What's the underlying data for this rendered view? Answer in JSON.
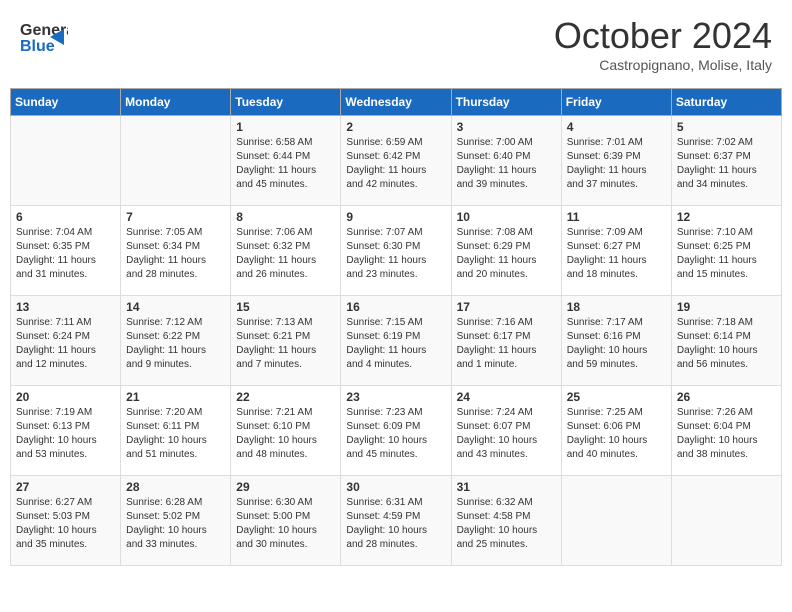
{
  "header": {
    "logo_general": "General",
    "logo_blue": "Blue",
    "month_title": "October 2024",
    "subtitle": "Castropignano, Molise, Italy"
  },
  "days_of_week": [
    "Sunday",
    "Monday",
    "Tuesday",
    "Wednesday",
    "Thursday",
    "Friday",
    "Saturday"
  ],
  "weeks": [
    [
      {
        "day": "",
        "content": ""
      },
      {
        "day": "",
        "content": ""
      },
      {
        "day": "1",
        "content": "Sunrise: 6:58 AM\nSunset: 6:44 PM\nDaylight: 11 hours and 45 minutes."
      },
      {
        "day": "2",
        "content": "Sunrise: 6:59 AM\nSunset: 6:42 PM\nDaylight: 11 hours and 42 minutes."
      },
      {
        "day": "3",
        "content": "Sunrise: 7:00 AM\nSunset: 6:40 PM\nDaylight: 11 hours and 39 minutes."
      },
      {
        "day": "4",
        "content": "Sunrise: 7:01 AM\nSunset: 6:39 PM\nDaylight: 11 hours and 37 minutes."
      },
      {
        "day": "5",
        "content": "Sunrise: 7:02 AM\nSunset: 6:37 PM\nDaylight: 11 hours and 34 minutes."
      }
    ],
    [
      {
        "day": "6",
        "content": "Sunrise: 7:04 AM\nSunset: 6:35 PM\nDaylight: 11 hours and 31 minutes."
      },
      {
        "day": "7",
        "content": "Sunrise: 7:05 AM\nSunset: 6:34 PM\nDaylight: 11 hours and 28 minutes."
      },
      {
        "day": "8",
        "content": "Sunrise: 7:06 AM\nSunset: 6:32 PM\nDaylight: 11 hours and 26 minutes."
      },
      {
        "day": "9",
        "content": "Sunrise: 7:07 AM\nSunset: 6:30 PM\nDaylight: 11 hours and 23 minutes."
      },
      {
        "day": "10",
        "content": "Sunrise: 7:08 AM\nSunset: 6:29 PM\nDaylight: 11 hours and 20 minutes."
      },
      {
        "day": "11",
        "content": "Sunrise: 7:09 AM\nSunset: 6:27 PM\nDaylight: 11 hours and 18 minutes."
      },
      {
        "day": "12",
        "content": "Sunrise: 7:10 AM\nSunset: 6:25 PM\nDaylight: 11 hours and 15 minutes."
      }
    ],
    [
      {
        "day": "13",
        "content": "Sunrise: 7:11 AM\nSunset: 6:24 PM\nDaylight: 11 hours and 12 minutes."
      },
      {
        "day": "14",
        "content": "Sunrise: 7:12 AM\nSunset: 6:22 PM\nDaylight: 11 hours and 9 minutes."
      },
      {
        "day": "15",
        "content": "Sunrise: 7:13 AM\nSunset: 6:21 PM\nDaylight: 11 hours and 7 minutes."
      },
      {
        "day": "16",
        "content": "Sunrise: 7:15 AM\nSunset: 6:19 PM\nDaylight: 11 hours and 4 minutes."
      },
      {
        "day": "17",
        "content": "Sunrise: 7:16 AM\nSunset: 6:17 PM\nDaylight: 11 hours and 1 minute."
      },
      {
        "day": "18",
        "content": "Sunrise: 7:17 AM\nSunset: 6:16 PM\nDaylight: 10 hours and 59 minutes."
      },
      {
        "day": "19",
        "content": "Sunrise: 7:18 AM\nSunset: 6:14 PM\nDaylight: 10 hours and 56 minutes."
      }
    ],
    [
      {
        "day": "20",
        "content": "Sunrise: 7:19 AM\nSunset: 6:13 PM\nDaylight: 10 hours and 53 minutes."
      },
      {
        "day": "21",
        "content": "Sunrise: 7:20 AM\nSunset: 6:11 PM\nDaylight: 10 hours and 51 minutes."
      },
      {
        "day": "22",
        "content": "Sunrise: 7:21 AM\nSunset: 6:10 PM\nDaylight: 10 hours and 48 minutes."
      },
      {
        "day": "23",
        "content": "Sunrise: 7:23 AM\nSunset: 6:09 PM\nDaylight: 10 hours and 45 minutes."
      },
      {
        "day": "24",
        "content": "Sunrise: 7:24 AM\nSunset: 6:07 PM\nDaylight: 10 hours and 43 minutes."
      },
      {
        "day": "25",
        "content": "Sunrise: 7:25 AM\nSunset: 6:06 PM\nDaylight: 10 hours and 40 minutes."
      },
      {
        "day": "26",
        "content": "Sunrise: 7:26 AM\nSunset: 6:04 PM\nDaylight: 10 hours and 38 minutes."
      }
    ],
    [
      {
        "day": "27",
        "content": "Sunrise: 6:27 AM\nSunset: 5:03 PM\nDaylight: 10 hours and 35 minutes."
      },
      {
        "day": "28",
        "content": "Sunrise: 6:28 AM\nSunset: 5:02 PM\nDaylight: 10 hours and 33 minutes."
      },
      {
        "day": "29",
        "content": "Sunrise: 6:30 AM\nSunset: 5:00 PM\nDaylight: 10 hours and 30 minutes."
      },
      {
        "day": "30",
        "content": "Sunrise: 6:31 AM\nSunset: 4:59 PM\nDaylight: 10 hours and 28 minutes."
      },
      {
        "day": "31",
        "content": "Sunrise: 6:32 AM\nSunset: 4:58 PM\nDaylight: 10 hours and 25 minutes."
      },
      {
        "day": "",
        "content": ""
      },
      {
        "day": "",
        "content": ""
      }
    ]
  ]
}
